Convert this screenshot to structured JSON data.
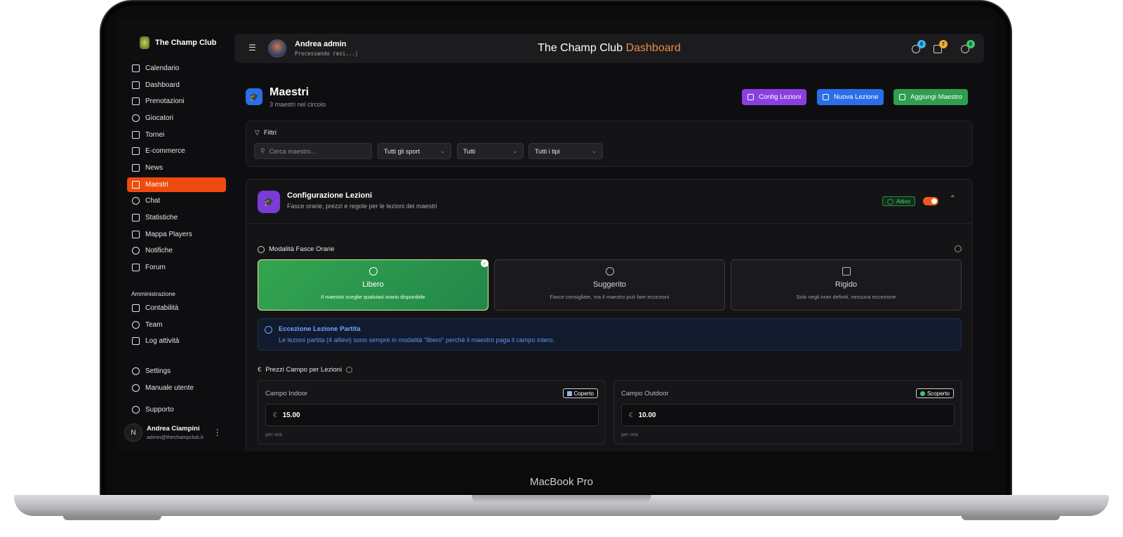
{
  "device": {
    "label": "MacBook Pro"
  },
  "sidebar": {
    "brand": "The Champ Club",
    "items": [
      {
        "label": "Calendario",
        "icon": "calendar-icon"
      },
      {
        "label": "Dashboard",
        "icon": "grid-icon"
      },
      {
        "label": "Prenotazioni",
        "icon": "calendar-check-icon"
      },
      {
        "label": "Giocatori",
        "icon": "users-icon"
      },
      {
        "label": "Tornei",
        "icon": "trophy-icon"
      },
      {
        "label": "E-commerce",
        "icon": "cart-icon"
      },
      {
        "label": "News",
        "icon": "newspaper-icon"
      },
      {
        "label": "Maestri",
        "icon": "graduation-cap-icon",
        "active": true
      },
      {
        "label": "Chat",
        "icon": "chat-icon"
      },
      {
        "label": "Statistiche",
        "icon": "bar-chart-icon"
      },
      {
        "label": "Mappa Players",
        "icon": "map-icon"
      },
      {
        "label": "Notifiche",
        "icon": "bell-icon"
      },
      {
        "label": "Forum",
        "icon": "forum-icon"
      }
    ],
    "admin_label": "Amministrazione",
    "admin_items": [
      {
        "label": "Contabilità",
        "icon": "ledger-icon"
      },
      {
        "label": "Team",
        "icon": "team-icon"
      },
      {
        "label": "Log attività",
        "icon": "log-icon"
      }
    ],
    "footer_items": [
      {
        "label": "Settings",
        "icon": "gear-icon"
      },
      {
        "label": "Manuale utente",
        "icon": "help-icon"
      },
      {
        "label": "Supporto",
        "icon": "headset-icon"
      }
    ],
    "user": {
      "initial": "N",
      "name": "Andrea Ciampini",
      "email": "admin@thechampclub.it"
    }
  },
  "header": {
    "user_name": "Andrea  admin",
    "status": "Processando resi...|",
    "title": "The Champ Club",
    "title_accent": "Dashboard",
    "badges": [
      {
        "icon": "globe-icon",
        "count": "6",
        "color": "#3ab4f2"
      },
      {
        "icon": "trend-icon",
        "count": "7",
        "color": "#f2a93a"
      },
      {
        "icon": "earth-icon",
        "count": "6",
        "color": "#3ec66a"
      }
    ]
  },
  "page": {
    "title": "Maestri",
    "subtitle": "3 maestri nel circolo",
    "buttons": [
      {
        "label": "Config Lezioni",
        "color": "#8a3fe0"
      },
      {
        "label": "Nuova Lezione",
        "color": "#2a6ee8"
      },
      {
        "label": "Aggiungi Maestro",
        "color": "#2f9e4e"
      }
    ]
  },
  "filters": {
    "label": "Filtri",
    "search_placeholder": "Cerca maestro...",
    "selects": [
      "Tutti gli sport",
      "Tutti",
      "Tutti i tipi"
    ]
  },
  "config": {
    "title": "Configurazione Lezioni",
    "subtitle": "Fasce orarie, prezzi e regole per le lezioni dei maestri",
    "status": "Attivo",
    "modes_label": "Modalità Fasce Orarie",
    "modes": [
      {
        "title": "Libero",
        "desc": "Il maestro sceglie qualsiasi orario disponibile",
        "selected": true,
        "icon": "target-icon"
      },
      {
        "title": "Suggerito",
        "desc": "Fasce consigliate, ma il maestro può fare eccezioni",
        "selected": false,
        "icon": "bulb-icon"
      },
      {
        "title": "Rigido",
        "desc": "Solo negli orari definiti, nessuna eccezione",
        "selected": false,
        "icon": "lock-icon"
      }
    ],
    "exception_title": "Eccezione Lezione Partita",
    "exception_text": "Le lezioni partita (4 allievi) sono sempre in modalità \"libero\" perché il maestro paga il campo intero.",
    "prices_label": "Prezzi Campo per Lezioni",
    "prices": [
      {
        "label": "Campo Indoor",
        "tag": "Coperto",
        "tag_color": "#8fb8e8",
        "currency": "€",
        "value": "15.00",
        "unit": "per ora"
      },
      {
        "label": "Campo Outdoor",
        "tag": "Scoperto",
        "tag_color": "#3ec66a",
        "currency": "€",
        "value": "10.00",
        "unit": "per ora"
      }
    ]
  }
}
